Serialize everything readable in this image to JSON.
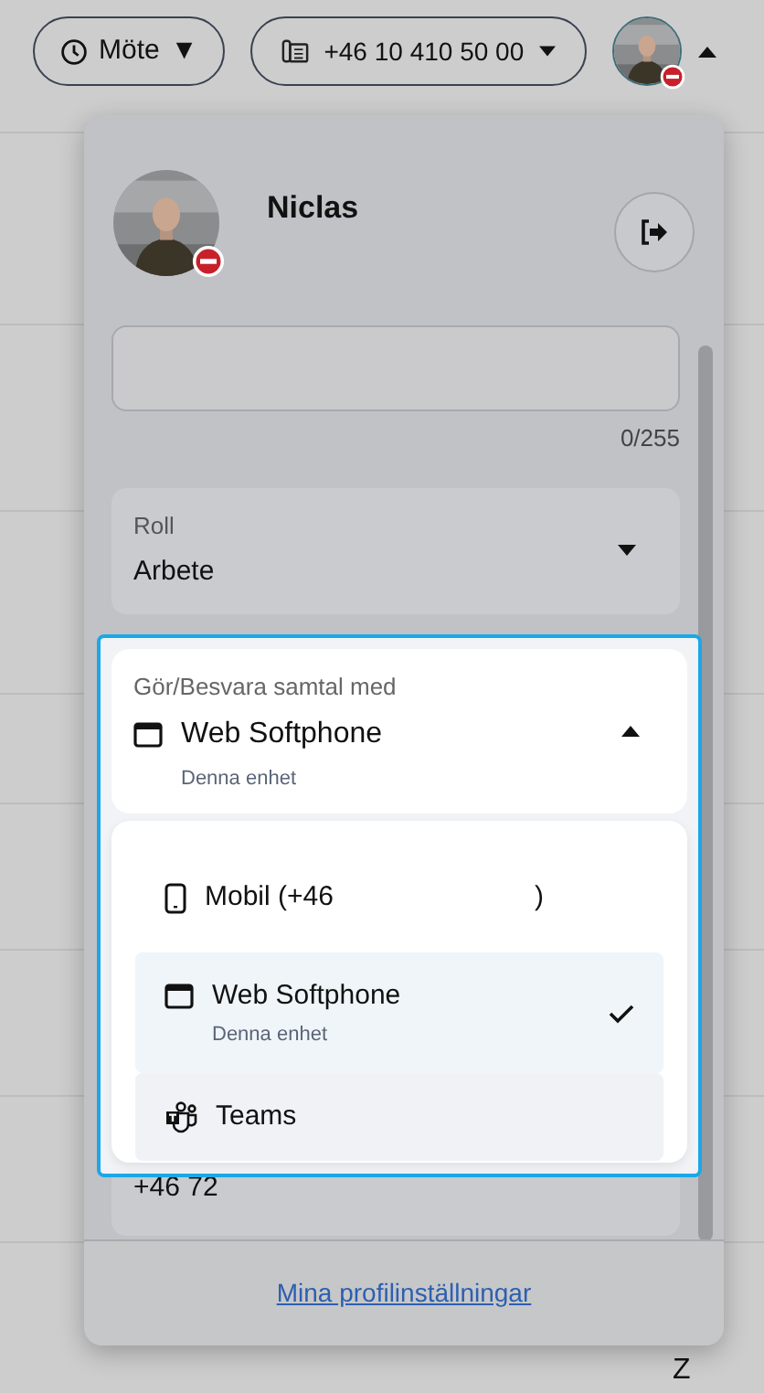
{
  "status_button": {
    "label": "Möte",
    "caret": "▼"
  },
  "phone_button": {
    "label": "+46 10 410 50 00"
  },
  "user_menu": {
    "expanded": true,
    "do_not_disturb": true
  },
  "profile": {
    "name": "Niclas",
    "do_not_disturb": true
  },
  "note_field": {
    "counter": "0/255"
  },
  "role_field": {
    "label": "Roll",
    "value": "Arbete",
    "expanded": false
  },
  "call_with": {
    "label": "Gör/Besvara samtal med",
    "value": "Web Softphone",
    "sub": "Denna enhet",
    "expanded": true,
    "options": [
      {
        "kind": "mobile",
        "label": [
          "Mobil (+46",
          ")"
        ],
        "selected": false,
        "highlighted": false
      },
      {
        "kind": "browser",
        "label": [
          "Web Softphone"
        ],
        "sub": "Denna enhet",
        "selected": true,
        "highlighted": false
      },
      {
        "kind": "teams",
        "label": [
          "Teams"
        ],
        "selected": false,
        "highlighted": true
      }
    ]
  },
  "mobile_field": {
    "value": "+46 72"
  },
  "footer_link": "Mina profilinställningar",
  "corner_text": "Z"
}
